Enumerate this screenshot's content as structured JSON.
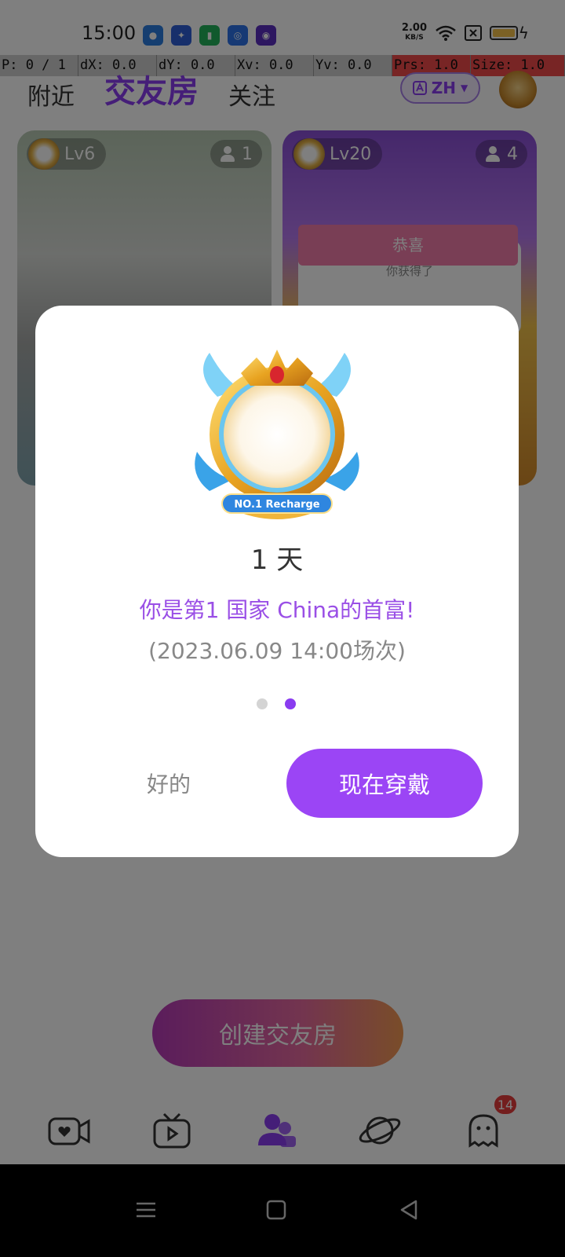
{
  "status_bar": {
    "time": "15:00",
    "net_speed_value": "2.00",
    "net_speed_unit": "KB/S"
  },
  "debug_bar": [
    {
      "text": "P: 0 / 1",
      "color": "#cfcfcf"
    },
    {
      "text": "dX: 0.0",
      "color": "#cfcfcf"
    },
    {
      "text": "dY: 0.0",
      "color": "#cfcfcf"
    },
    {
      "text": "Xv: 0.0",
      "color": "#cfcfcf"
    },
    {
      "text": "Yv: 0.0",
      "color": "#cfcfcf"
    },
    {
      "text": "Prs: 1.0",
      "color": "#f04a4a"
    },
    {
      "text": "Size: 1.0",
      "color": "#f04a4a"
    }
  ],
  "top_tabs": [
    {
      "label": "附近",
      "active": false
    },
    {
      "label": "交友房",
      "active": true
    },
    {
      "label": "关注",
      "active": false
    }
  ],
  "language": {
    "label": "ZH"
  },
  "rooms": [
    {
      "level": "Lv6",
      "members": "1"
    },
    {
      "level": "Lv20",
      "members": "4",
      "overlay_title": "恭喜",
      "overlay_text": "你获得了"
    }
  ],
  "create_button": "创建交友房",
  "bottom_nav": {
    "items": [
      "video-chat",
      "live-tv",
      "friend-rooms",
      "explore-planet",
      "messages"
    ],
    "messages_badge": "14"
  },
  "dialog": {
    "frame_label": "NO.1 Recharge",
    "duration": "1 天",
    "message": "你是第1 国家 China的首富!",
    "session": "(2023.06.09 14:00场次)",
    "pager": {
      "count": 2,
      "active": 2
    },
    "ok_button": "好的",
    "wear_button": "现在穿戴"
  },
  "colors": {
    "accent": "#8a3cf0",
    "button_purple": "#9b45f5",
    "badge_red": "#e63c3c"
  }
}
